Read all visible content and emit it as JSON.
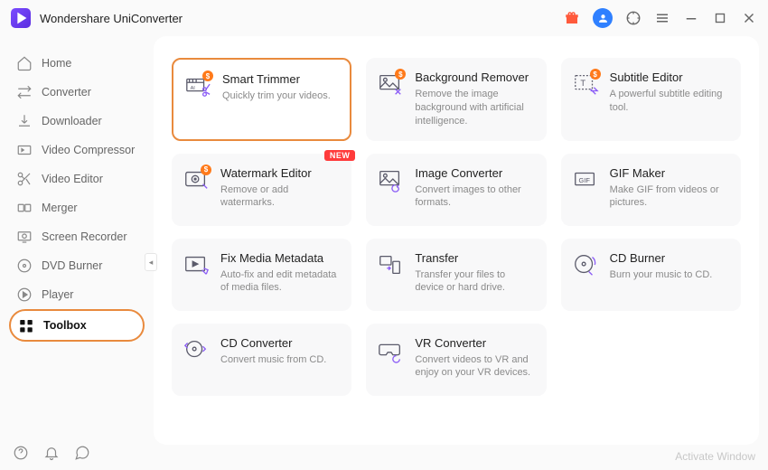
{
  "app": {
    "title": "Wondershare UniConverter"
  },
  "sidebar": {
    "items": [
      {
        "label": "Home"
      },
      {
        "label": "Converter"
      },
      {
        "label": "Downloader"
      },
      {
        "label": "Video Compressor"
      },
      {
        "label": "Video Editor"
      },
      {
        "label": "Merger"
      },
      {
        "label": "Screen Recorder"
      },
      {
        "label": "DVD Burner"
      },
      {
        "label": "Player"
      },
      {
        "label": "Toolbox"
      }
    ]
  },
  "cards": [
    {
      "title": "Smart Trimmer",
      "desc": "Quickly trim your videos.",
      "dollar": true
    },
    {
      "title": "Background Remover",
      "desc": "Remove the image background with artificial intelligence.",
      "dollar": true
    },
    {
      "title": "Subtitle Editor",
      "desc": "A powerful subtitle editing tool.",
      "dollar": true
    },
    {
      "title": "Watermark Editor",
      "desc": "Remove or add watermarks.",
      "dollar": true,
      "new": true
    },
    {
      "title": "Image Converter",
      "desc": "Convert images to other formats."
    },
    {
      "title": "GIF Maker",
      "desc": "Make GIF from videos or pictures."
    },
    {
      "title": "Fix Media Metadata",
      "desc": "Auto-fix and edit metadata of media files."
    },
    {
      "title": "Transfer",
      "desc": "Transfer your files to device or hard drive."
    },
    {
      "title": "CD Burner",
      "desc": "Burn your music to CD."
    },
    {
      "title": "CD Converter",
      "desc": "Convert music from CD."
    },
    {
      "title": "VR Converter",
      "desc": "Convert videos to VR and enjoy on your VR devices."
    }
  ],
  "badges": {
    "new": "NEW",
    "dollar": "$"
  },
  "watermark": "Activate Window"
}
